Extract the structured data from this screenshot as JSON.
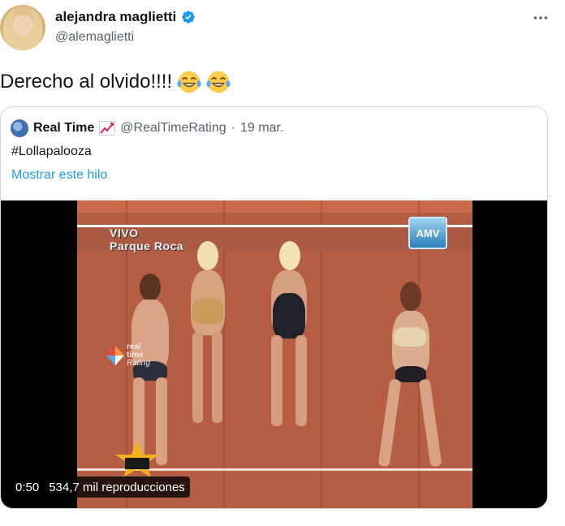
{
  "tweet": {
    "author_name": "alejandra maglietti",
    "author_handle": "@alemaglietti",
    "text": "Derecho al olvido!!!!",
    "emojis": [
      "face-with-tears-of-joy",
      "face-with-tears-of-joy"
    ]
  },
  "quote": {
    "author_name": "Real Time",
    "author_handle": "@RealTimeRating",
    "separator": "·",
    "date": "19 mar.",
    "text": "#Lollapalooza",
    "show_thread_label": "Mostrar este hilo"
  },
  "video": {
    "overlay_top": [
      "VIVO",
      "Parque Roca"
    ],
    "channel_logo": "AMV",
    "watermark": [
      "real",
      "time",
      "Rating"
    ],
    "time": "0:50",
    "views": "534,7 mil reproducciones"
  },
  "colors": {
    "link": "#1d9bf0",
    "verified": "#1d9bf0",
    "secondary_text": "#536471",
    "border": "#cfd9de"
  }
}
